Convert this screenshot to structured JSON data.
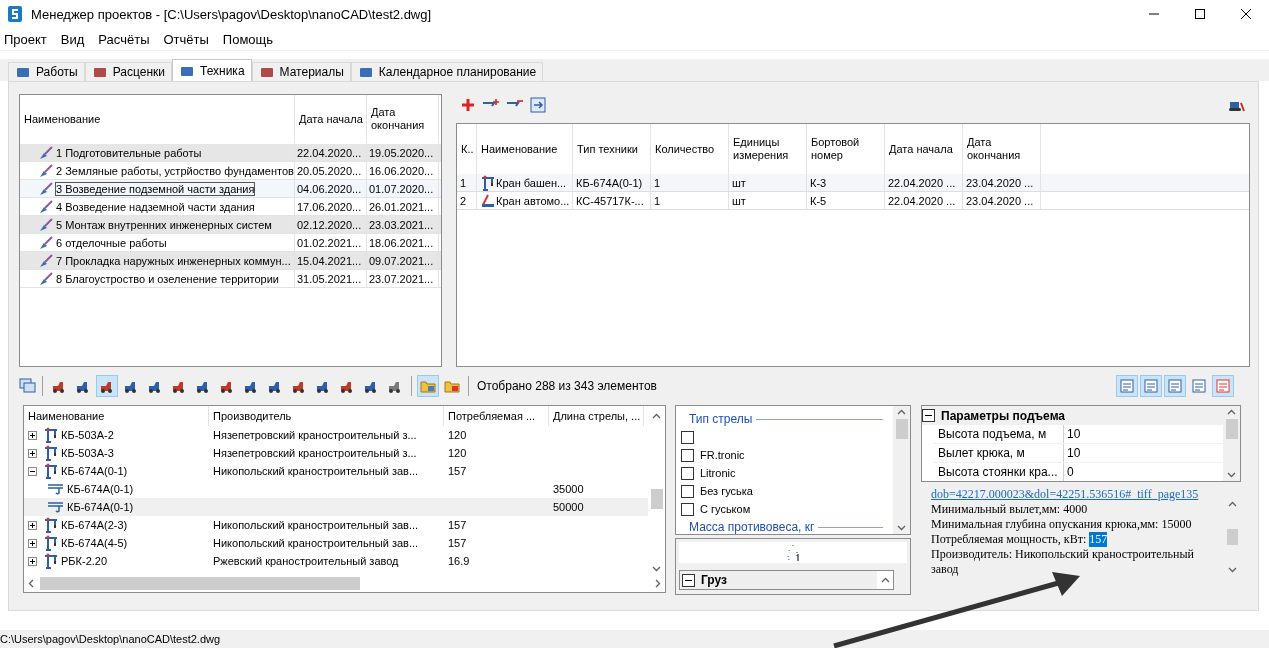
{
  "window": {
    "title": "Менеджер проектов - [C:\\Users\\pagov\\Desktop\\nanoCAD\\test2.dwg]"
  },
  "menu": [
    "Проект",
    "Вид",
    "Расчёты",
    "Отчёты",
    "Помощь"
  ],
  "tabs": [
    {
      "label": "Работы",
      "selected": false
    },
    {
      "label": "Расценки",
      "selected": false
    },
    {
      "label": "Техника",
      "selected": true
    },
    {
      "label": "Материалы",
      "selected": false
    },
    {
      "label": "Календарное планирование",
      "selected": false
    }
  ],
  "works_table": {
    "columns": [
      "Наименование",
      "Дата начала",
      "Дата окончания"
    ],
    "rows": [
      {
        "cells": [
          "1 Подготовительные работы",
          "22.04.2020...",
          "19.05.2020..."
        ],
        "highlighted": true,
        "selected": false
      },
      {
        "cells": [
          "2 Земляные работы, устрйоство фундаментов",
          "20.05.2020...",
          "16.06.2020..."
        ],
        "highlighted": false,
        "selected": false
      },
      {
        "cells": [
          "3 Возведение подземной части здания",
          "04.06.2020...",
          "01.07.2020..."
        ],
        "highlighted": false,
        "selected": true
      },
      {
        "cells": [
          "4 Возведение надземной части здания",
          "17.06.2020...",
          "26.01.2021..."
        ],
        "highlighted": false,
        "selected": false
      },
      {
        "cells": [
          "5 Монтаж внутренних инженерных систем",
          "02.12.2020...",
          "23.03.2021..."
        ],
        "highlighted": true,
        "selected": false
      },
      {
        "cells": [
          "6 отделочные работы",
          "01.02.2021...",
          "18.06.2021..."
        ],
        "highlighted": false,
        "selected": false
      },
      {
        "cells": [
          "7 Прокладка наружных инженерных коммун...",
          "15.04.2021...",
          "09.07.2021..."
        ],
        "highlighted": true,
        "selected": false
      },
      {
        "cells": [
          "8 Благоустроство и озеленение территории",
          "31.05.2021...",
          "23.07.2021..."
        ],
        "highlighted": false,
        "selected": false
      }
    ]
  },
  "equipment_table": {
    "columns": [
      "К..",
      "Наименование",
      "Тип техники",
      "Количество",
      "Единицы измерения",
      "Бортовой номер",
      "Дата начала",
      "Дата окончания"
    ],
    "rows": [
      {
        "kind": "tower",
        "cells": [
          "1",
          "Кран башен...",
          "КБ-674А(0-1)",
          "1",
          "шт",
          "К-3",
          "22.04.2020 ...",
          "23.04.2020 ..."
        ]
      },
      {
        "kind": "mobile",
        "cells": [
          "2",
          "Кран автомо...",
          "КС-45717К-...",
          "1",
          "шт",
          "К-5",
          "22.04.2020 ...",
          "23.04.2020 ..."
        ]
      }
    ]
  },
  "filter_toolbar": {
    "filters": [
      {
        "selected": false
      },
      {
        "selected": false
      },
      {
        "selected": true
      },
      {
        "selected": false
      },
      {
        "selected": false
      },
      {
        "selected": false
      },
      {
        "selected": false
      },
      {
        "selected": false
      },
      {
        "selected": false
      },
      {
        "selected": false
      },
      {
        "selected": false
      },
      {
        "selected": false
      },
      {
        "selected": false
      },
      {
        "selected": false
      },
      {
        "selected": false
      }
    ],
    "views": [
      {
        "selected": true
      },
      {
        "selected": false
      }
    ],
    "status": "Отобрано 288 из 343 элементов",
    "options": [
      {
        "selected": true
      },
      {
        "selected": true
      },
      {
        "selected": true
      },
      {
        "selected": false
      },
      {
        "selected": true
      }
    ]
  },
  "catalog_tree": {
    "columns": [
      "Наименование",
      "Производитель",
      "Потребляемая ...",
      "Длина стрелы, ..."
    ],
    "rows": [
      {
        "kind": "model",
        "expanded": false,
        "selected": false,
        "cells": [
          "КБ-503А-2",
          "Нязепетровский краностроительный з...",
          "120",
          ""
        ]
      },
      {
        "kind": "model",
        "expanded": false,
        "selected": false,
        "cells": [
          "КБ-503А-3",
          "Нязепетровский краностроительный з...",
          "120",
          ""
        ]
      },
      {
        "kind": "model",
        "expanded": true,
        "selected": false,
        "cells": [
          "КБ-674А(0-1)",
          "Никопольский краностроительный зав...",
          "157",
          ""
        ]
      },
      {
        "kind": "variant",
        "selected": false,
        "cells": [
          "КБ-674А(0-1)",
          "",
          "",
          "35000"
        ]
      },
      {
        "kind": "variant",
        "selected": true,
        "cells": [
          "КБ-674А(0-1)",
          "",
          "",
          "50000"
        ]
      },
      {
        "kind": "model",
        "expanded": false,
        "selected": false,
        "cells": [
          "КБ-674А(2-3)",
          "Никопольский краностроительный зав...",
          "157",
          ""
        ]
      },
      {
        "kind": "model",
        "expanded": false,
        "selected": false,
        "cells": [
          "КБ-674А(4-5)",
          "Никопольский краностроительный зав...",
          "157",
          ""
        ]
      },
      {
        "kind": "model",
        "expanded": false,
        "selected": false,
        "cells": [
          "РБК-2.20",
          "Ржевский краностроительный завод",
          "16.9",
          ""
        ]
      }
    ]
  },
  "boom_filter": {
    "heading": "Тип стрелы",
    "options": [
      {
        "checked": false
      },
      {
        "label": "FR.tronic",
        "checked": false
      },
      {
        "label": "Litronic",
        "checked": false
      },
      {
        "label": "Без гуська",
        "checked": false
      },
      {
        "label": "С гуськом",
        "checked": false
      }
    ],
    "next_heading": "Масса противовеса, кг"
  },
  "load_section": {
    "title": "Груз",
    "expanded": true
  },
  "lifting_params": {
    "title": "Параметры подъема",
    "expanded": true,
    "rows": [
      {
        "name": "Высота подъема, м",
        "value": "10"
      },
      {
        "name": "Вылет крюка, м",
        "value": "10"
      },
      {
        "name": "Высота стоянки кра...",
        "value": "0"
      }
    ]
  },
  "info": {
    "link": "dob=42217.000023&dol=42251.536516#_tiff_page135",
    "lines": [
      {
        "text": "Минимальный вылет,мм: 4000",
        "highlighted": false
      },
      {
        "text": "Минимальная глубина опускания крюка,мм: 15000",
        "highlighted": false
      },
      {
        "text": "Потребляемая мощность, кВт:",
        "value": "157",
        "highlighted": true
      },
      {
        "text": "Производитель: Никопольский краностроительный завод",
        "highlighted": false
      }
    ]
  },
  "status_bar": "C:\\Users\\pagov\\Desktop\\nanoCAD\\test2.dwg"
}
